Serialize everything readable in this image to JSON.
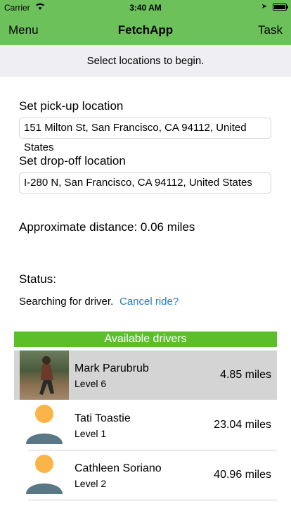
{
  "status_bar": {
    "carrier": "Carrier",
    "time": "3:40 AM"
  },
  "nav": {
    "menu": "Menu",
    "title": "FetchApp",
    "task": "Task"
  },
  "banner": "Select locations to begin.",
  "pickup": {
    "label": "Set pick-up location",
    "value": "151 Milton St, San Francisco, CA  94112, United States"
  },
  "dropoff": {
    "label": "Set drop-off location",
    "value": "I-280 N, San Francisco, CA  94112, United States"
  },
  "distance": "Approximate distance: 0.06 miles",
  "status": {
    "label": "Status:",
    "text": "Searching for driver.",
    "cancel": "Cancel ride?"
  },
  "drivers": {
    "header": "Available drivers",
    "items": [
      {
        "name": "Mark Parubrub",
        "level": "Level 6",
        "distance": "4.85 miles"
      },
      {
        "name": "Tati Toastie",
        "level": "Level 1",
        "distance": "23.04 miles"
      },
      {
        "name": "Cathleen Soriano",
        "level": "Level 2",
        "distance": "40.96 miles"
      }
    ]
  },
  "colors": {
    "accent": "#6cc15a",
    "header_green": "#5cbf2a",
    "link": "#1a7fd6",
    "avatar_head": "#fbb447",
    "avatar_body": "#5a7785"
  }
}
